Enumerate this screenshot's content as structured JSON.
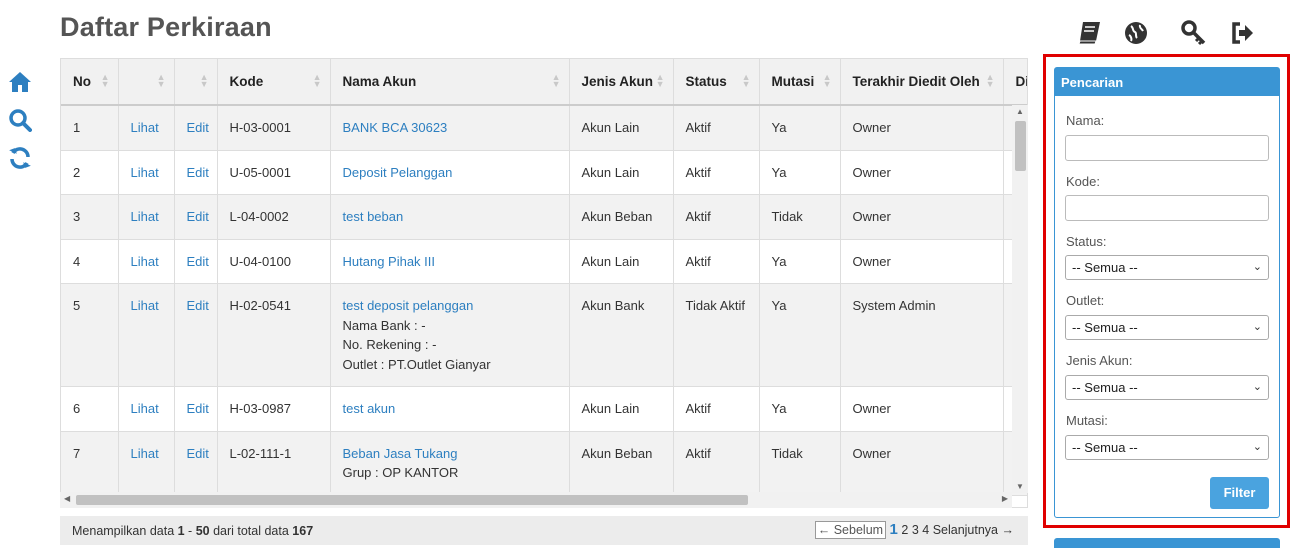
{
  "page_title": "Daftar Perkiraan",
  "left_icons": [
    "home-icon",
    "search-icon",
    "refresh-icon"
  ],
  "top_icons": [
    "book-icon",
    "globe-icon",
    "key-icon",
    "sign-out-icon"
  ],
  "colors": {
    "accent": "#3a95d4",
    "link": "#2d7fc0",
    "highlight_border": "#e00000"
  },
  "table": {
    "columns": [
      "No",
      "",
      "",
      "Kode",
      "Nama Akun",
      "Jenis Akun",
      "Status",
      "Mutasi",
      "Terakhir Diedit Oleh",
      "Dil"
    ],
    "rows": [
      {
        "no": "1",
        "view": "Lihat",
        "edit": "Edit",
        "kode": "H-03-0001",
        "nama": "BANK BCA 30623",
        "extra": [],
        "jenis": "Akun Lain",
        "status": "Aktif",
        "mutasi": "Ya",
        "editor": "Owner"
      },
      {
        "no": "2",
        "view": "Lihat",
        "edit": "Edit",
        "kode": "U-05-0001",
        "nama": "Deposit Pelanggan",
        "extra": [],
        "jenis": "Akun Lain",
        "status": "Aktif",
        "mutasi": "Ya",
        "editor": "Owner"
      },
      {
        "no": "3",
        "view": "Lihat",
        "edit": "Edit",
        "kode": "L-04-0002",
        "nama": "test beban",
        "extra": [],
        "jenis": "Akun Beban",
        "status": "Aktif",
        "mutasi": "Tidak",
        "editor": "Owner"
      },
      {
        "no": "4",
        "view": "Lihat",
        "edit": "Edit",
        "kode": "U-04-0100",
        "nama": "Hutang Pihak III",
        "extra": [],
        "jenis": "Akun Lain",
        "status": "Aktif",
        "mutasi": "Ya",
        "editor": "Owner"
      },
      {
        "no": "5",
        "view": "Lihat",
        "edit": "Edit",
        "kode": "H-02-0541",
        "nama": "test deposit pelanggan",
        "extra": [
          "Nama Bank : -",
          "No. Rekening : -",
          "Outlet : PT.Outlet Gianyar"
        ],
        "jenis": "Akun Bank",
        "status": "Tidak Aktif",
        "mutasi": "Ya",
        "editor": "System Admin"
      },
      {
        "no": "6",
        "view": "Lihat",
        "edit": "Edit",
        "kode": "H-03-0987",
        "nama": "test akun",
        "extra": [],
        "jenis": "Akun Lain",
        "status": "Aktif",
        "mutasi": "Ya",
        "editor": "Owner"
      },
      {
        "no": "7",
        "view": "Lihat",
        "edit": "Edit",
        "kode": "L-02-111-1",
        "nama": "Beban Jasa Tukang",
        "extra": [
          "Grup : OP KANTOR"
        ],
        "jenis": "Akun Beban",
        "status": "Aktif",
        "mutasi": "Tidak",
        "editor": "Owner"
      }
    ]
  },
  "footer": {
    "info_prefix": "Menampilkan data ",
    "from": "1",
    "sep": " - ",
    "to": "50",
    "mid": " dari total data ",
    "total": "167",
    "prev": "← Sebelum",
    "pages": [
      "1",
      "2",
      "3",
      "4"
    ],
    "current_page": "1",
    "next": "Selanjutnya →"
  },
  "search_panel": {
    "title": "Pencarian",
    "nama_label": "Nama:",
    "nama_value": "",
    "kode_label": "Kode:",
    "kode_value": "",
    "status_label": "Status:",
    "status_value": "-- Semua --",
    "outlet_label": "Outlet:",
    "outlet_value": "-- Semua --",
    "jenis_label": "Jenis Akun:",
    "jenis_value": "-- Semua --",
    "mutasi_label": "Mutasi:",
    "mutasi_value": "-- Semua --",
    "filter_label": "Filter"
  }
}
